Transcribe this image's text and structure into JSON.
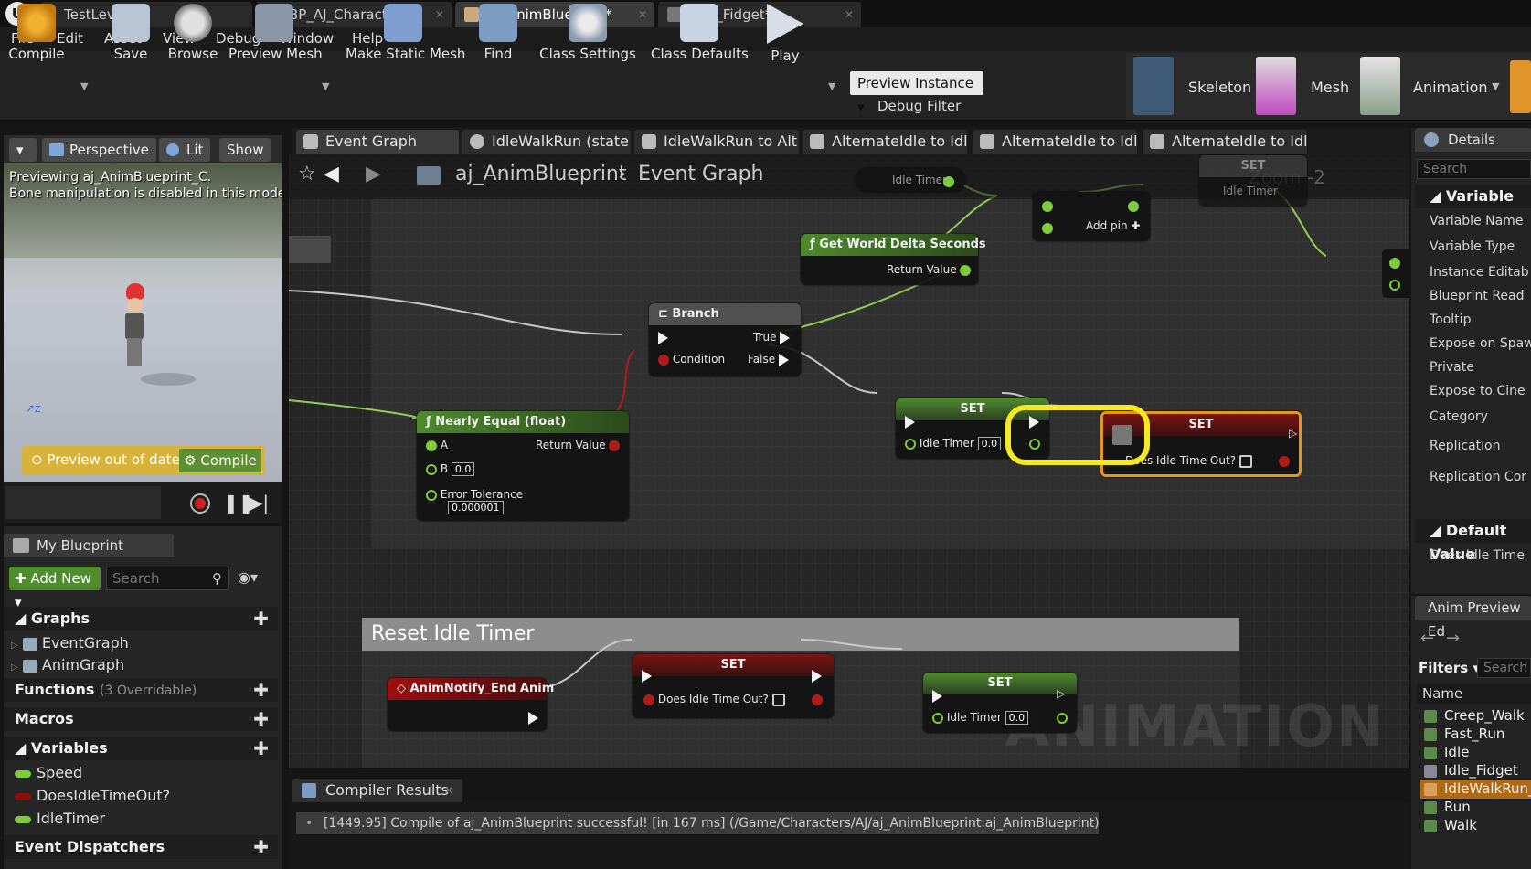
{
  "title_tabs": [
    "TestLevel",
    "BP_AJ_Character*",
    "aj_AnimBlueprint*",
    "Idle_Fidget*"
  ],
  "menu": [
    "File",
    "Edit",
    "Asset",
    "View",
    "Debug",
    "Window",
    "Help"
  ],
  "toolbar": {
    "compile": "Compile",
    "save": "Save",
    "browse": "Browse",
    "preview_mesh": "Preview Mesh",
    "make_static_mesh": "Make Static Mesh",
    "find": "Find",
    "class_settings": "Class Settings",
    "class_defaults": "Class Defaults",
    "play": "Play",
    "preview_instance": "Preview Instance",
    "debug_filter": "Debug Filter",
    "skeleton": "Skeleton",
    "mesh": "Mesh",
    "animation": "Animation"
  },
  "viewport": {
    "perspective": "Perspective",
    "lit": "Lit",
    "show": "Show",
    "preview_line1": "Previewing aj_AnimBlueprint_C.",
    "preview_line2": "Bone manipulation is disabled in this mode.",
    "out_of_date": "Preview out of date",
    "compile": "Compile"
  },
  "my_blueprint": {
    "tab": "My Blueprint",
    "add_new": "Add New",
    "search_placeholder": "Search",
    "graphs": "Graphs",
    "graph_items": [
      "EventGraph",
      "AnimGraph"
    ],
    "functions": "Functions",
    "functions_sub": "(3 Overridable)",
    "macros": "Macros",
    "variables": "Variables",
    "variable_items": [
      {
        "name": "Speed",
        "color": "#7ecb3c"
      },
      {
        "name": "DoesIdleTimeOut?",
        "color": "#8a0f0f"
      },
      {
        "name": "IdleTimer",
        "color": "#7ecb3c"
      }
    ],
    "event_dispatchers": "Event Dispatchers"
  },
  "graph_tabs": [
    "Event Graph",
    "IdleWalkRun (state",
    "IdleWalkRun to Alt",
    "AlternateIdle to Idl",
    "AlternateIdle to Idl",
    "AlternateIdle to Idl"
  ],
  "breadcrumb": {
    "bp": "aj_AnimBlueprint",
    "graph": "Event Graph"
  },
  "zoom": "Zoom -2",
  "comment_title": "Reset Idle Timer",
  "watermark": "ANIMATION",
  "nodes": {
    "get_idle_timer": "Idle Timer",
    "set_top": {
      "title": "SET",
      "pin": "Idle Timer"
    },
    "add": {
      "pin": "Add pin"
    },
    "world_delta": {
      "title": "Get World Delta Seconds",
      "out": "Return Value"
    },
    "branch": {
      "title": "Branch",
      "cond": "Condition",
      "true": "True",
      "false": "False"
    },
    "nearly_equal": {
      "title": "Nearly Equal (float)",
      "a": "A",
      "b": "B",
      "b_val": "0.0",
      "tol": "Error Tolerance",
      "tol_val": "0.000001",
      "out": "Return Value"
    },
    "set_idle": {
      "title": "SET",
      "pin": "Idle Timer",
      "val": "0.0"
    },
    "set_does": {
      "title": "SET",
      "pin": "Does Idle Time Out?"
    },
    "notify": {
      "title": "AnimNotify_End Anim"
    },
    "set_does2": {
      "title": "SET",
      "pin": "Does Idle Time Out?"
    },
    "set_idle2": {
      "title": "SET",
      "pin": "Idle Timer",
      "val": "0.0"
    }
  },
  "compiler": {
    "tab": "Compiler Results",
    "message": "[1449.95] Compile of aj_AnimBlueprint successful! [in 167 ms] (/Game/Characters/AJ/aj_AnimBlueprint.aj_AnimBlueprint)"
  },
  "details": {
    "tab": "Details",
    "search_placeholder": "Search",
    "variable_hdr": "Variable",
    "rows": [
      "Variable Name",
      "Variable Type",
      "Instance Editab",
      "Blueprint Read",
      "Tooltip",
      "Expose on Spaw",
      "Private",
      "Expose to Cine",
      "Category",
      "Replication",
      "Replication Cor"
    ],
    "default_hdr": "Default Value",
    "default_row": "Does Idle Time"
  },
  "anim_preview": {
    "tab": "Anim Preview Ed",
    "filters": "Filters",
    "search_placeholder": "Search",
    "col_name": "Name",
    "items": [
      "Creep_Walk",
      "Fast_Run",
      "Idle",
      "Idle_Fidget",
      "IdleWalkRun_",
      "Run",
      "Walk"
    ]
  }
}
